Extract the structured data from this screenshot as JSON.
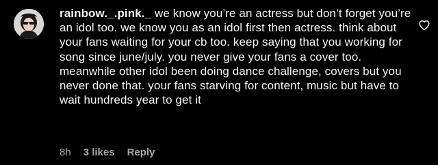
{
  "comment": {
    "username": "rainbow._.pink._",
    "text": "we know you’re an actress but don’t forget you’re an idol too. we know you as an idol first then actress. think about your fans waiting for your cb too. keep saying that you working for song since june/july. you never give your fans a cover too. meanwhile other idol been doing dance challenge, covers but you never done that. your fans starving for content, music but have to wait hundreds year to get it",
    "time": "8h",
    "likes": "3 likes",
    "reply_label": "Reply"
  },
  "colors": {
    "background": "#000000",
    "text": "#f5f5f5",
    "meta": "#a8a8a8"
  },
  "icons": {
    "avatar": "avatar",
    "like": "heart-outline-icon"
  }
}
